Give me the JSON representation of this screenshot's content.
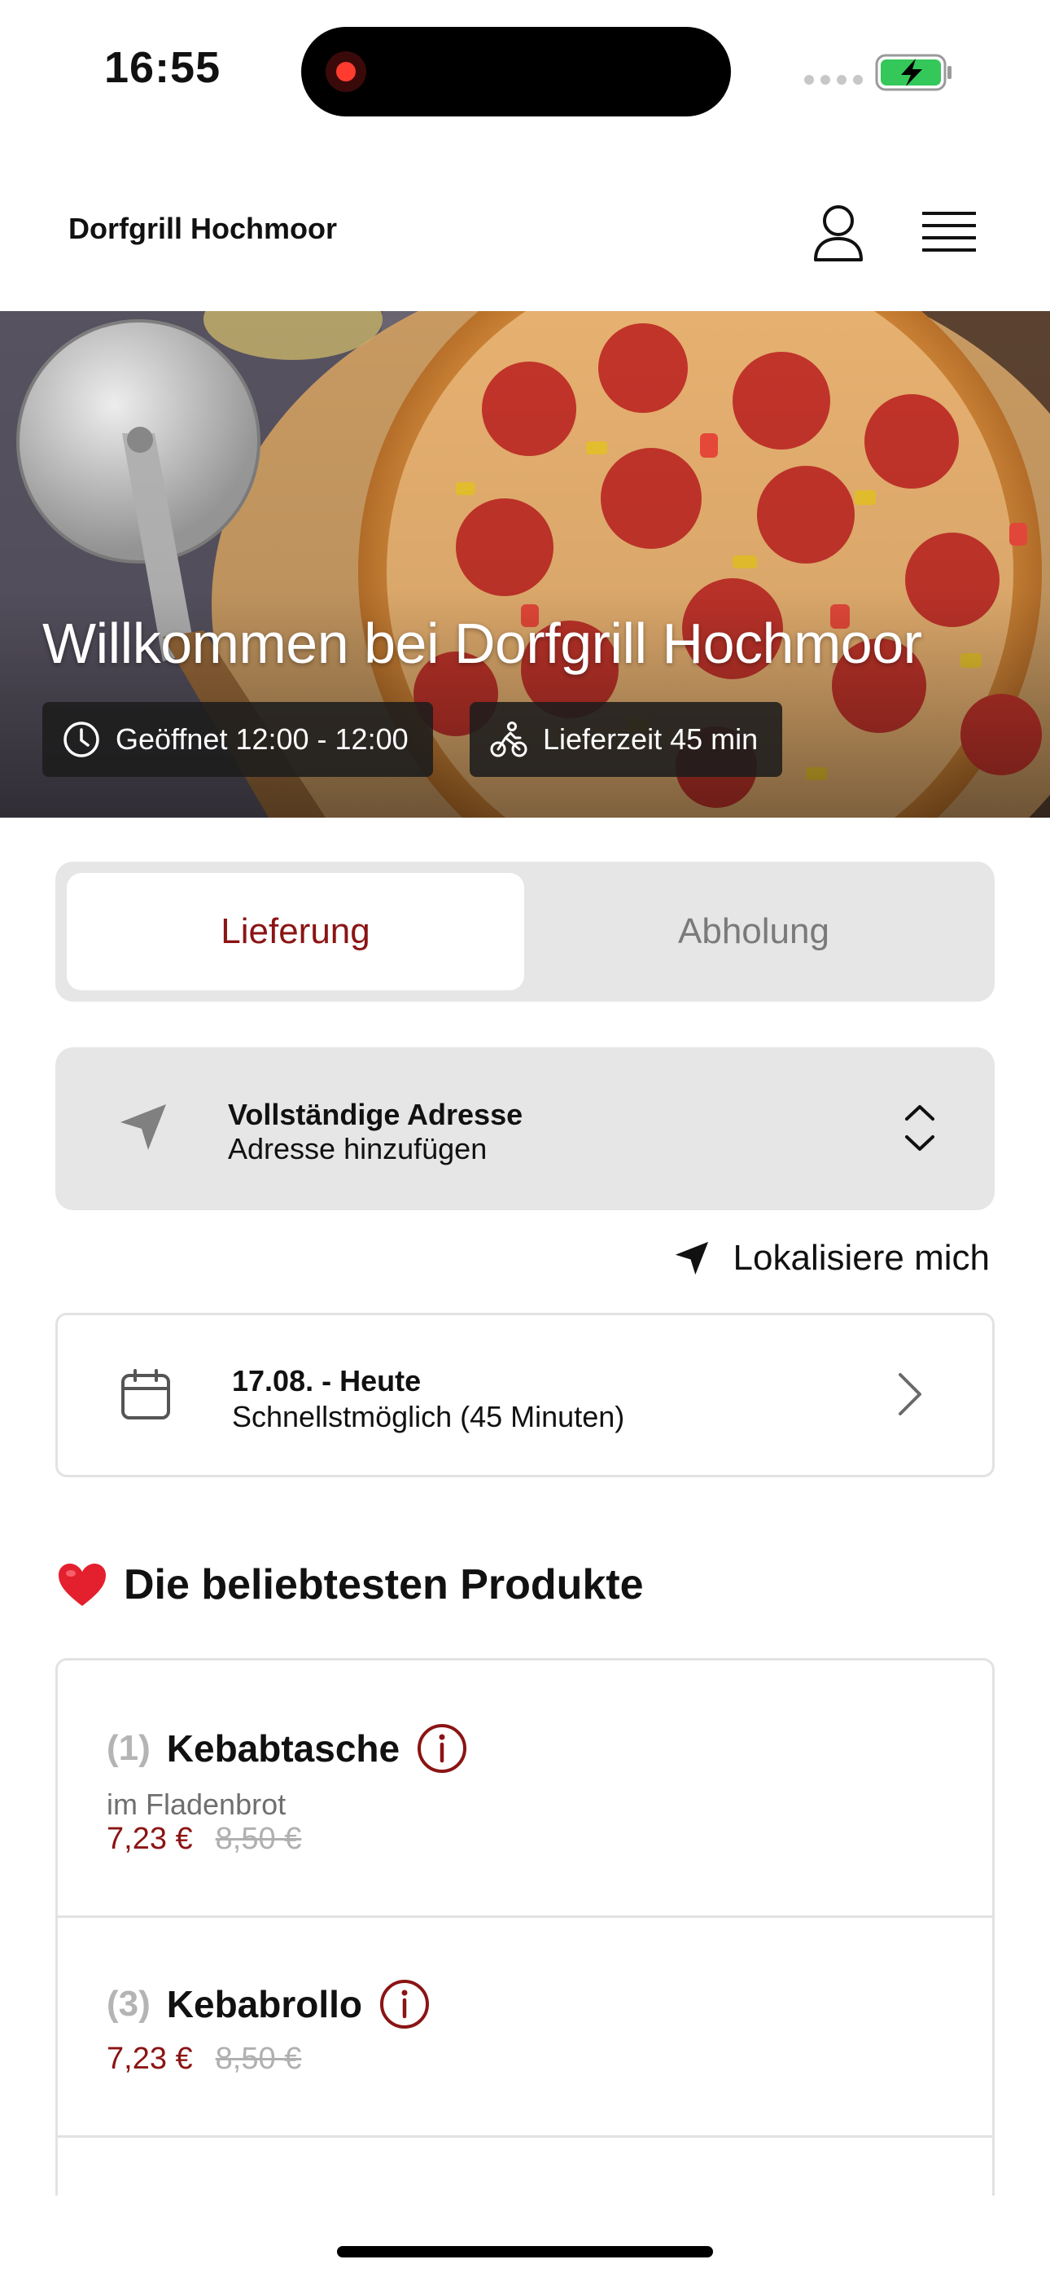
{
  "status_bar": {
    "time": "16:55"
  },
  "header": {
    "brand": "Dorfgrill Hochmoor"
  },
  "hero": {
    "title": "Willkommen bei Dorfgrill Hochmoor",
    "opening_label": "Geöffnet 12:00 - 12:00",
    "delivery_time_label": "Lieferzeit 45 min"
  },
  "mode_toggle": {
    "delivery": "Lieferung",
    "pickup": "Abholung",
    "selected": "delivery"
  },
  "address": {
    "title": "Vollständige Adresse",
    "subtitle": "Adresse hinzufügen"
  },
  "locate": {
    "label": "Lokalisiere mich"
  },
  "schedule": {
    "title": "17.08. - Heute",
    "subtitle": "Schnellstmöglich (45 Minuten)"
  },
  "popular": {
    "title": "Die beliebtesten Produkte",
    "items": [
      {
        "number": "(1)",
        "name": "Kebabtasche",
        "description": "im Fladenbrot",
        "price": "7,23 €",
        "old_price": "8,50 €"
      },
      {
        "number": "(3)",
        "name": "Kebabrollo",
        "price": "7,23 €",
        "old_price": "8,50 €"
      }
    ]
  },
  "colors": {
    "accent": "#8b1414",
    "card_bg": "#e6e6e6",
    "muted": "#7a7a7a"
  }
}
